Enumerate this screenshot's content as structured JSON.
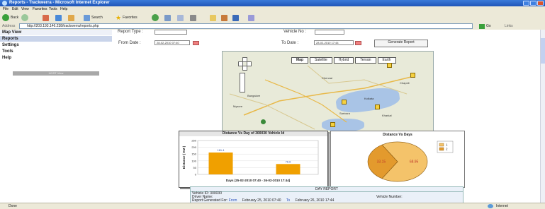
{
  "window": {
    "title": "Reports - Trackwerra - Microsoft Internet Explorer"
  },
  "menu": [
    "File",
    "Edit",
    "View",
    "Favorites",
    "Tools",
    "Help"
  ],
  "toolbar": {
    "back": "Back",
    "search": "Search",
    "favorites": "Favorites"
  },
  "address": {
    "label": "Address",
    "url": "http://203.193.146.238/trackwerra/reports.php",
    "go": "Go",
    "links": "Links"
  },
  "nav": {
    "items": [
      "Map View",
      "Reports",
      "Settings",
      "Tools",
      "Help"
    ],
    "selected": "Reports",
    "button": "HOST View"
  },
  "form": {
    "report_type_label": "Report Type :",
    "vehicle_no_label": "Vehicle No :",
    "from_label": "From Date :",
    "from_value": "28-02-2010 07:40",
    "to_label": "To Date :",
    "to_value": "28-02-2010 17:44",
    "generate": "Generate Report"
  },
  "map": {
    "tabs": [
      "Map",
      "Satellite",
      "Hybrid",
      "Terrain",
      "Earth"
    ],
    "active_tab": "Map",
    "places": [
      "Mysore",
      "Bangalore",
      "Chennai",
      "Kolkata",
      "Chapeli",
      "Kharkal",
      "Sarivara"
    ]
  },
  "chart_data": [
    {
      "type": "bar",
      "title": "Distance Vs Day of 300030 Vehicle Id",
      "categories": [
        "",
        ""
      ],
      "values": [
        161.4,
        76.6
      ],
      "data_labels": [
        "161.4",
        "76.6"
      ],
      "ylabel": "Distance ( KM )",
      "xlabel": "Days (25-02-2010 07:40 - 26-02-2010 17:44)",
      "ylim": [
        0,
        250
      ],
      "yticks": [
        "250",
        "200",
        "150",
        "100",
        "50",
        "0"
      ],
      "color": "#f0a000"
    },
    {
      "type": "pie",
      "title": "Distance Vs Days",
      "values": [
        68.95,
        33.15
      ],
      "data_labels": [
        "68.95",
        "33.15"
      ],
      "legend": [
        "1",
        "2"
      ],
      "colors": [
        "#f4c36a",
        "#e39a2d"
      ],
      "legend_position": "top-right"
    }
  ],
  "report": {
    "title": "DAY REPORT",
    "vehicle_id": "Vehicle ID: 300030",
    "driver": "Driver Name:",
    "vehicle_number": "Vehicle Number:",
    "generated_label": "Report Generated For:",
    "from_word": "From",
    "from_date": "February 25, 2010 07:40",
    "to_word": "To",
    "to_date": "February 26, 2010 17:44"
  },
  "status": {
    "left": "Done",
    "right": "Internet"
  }
}
